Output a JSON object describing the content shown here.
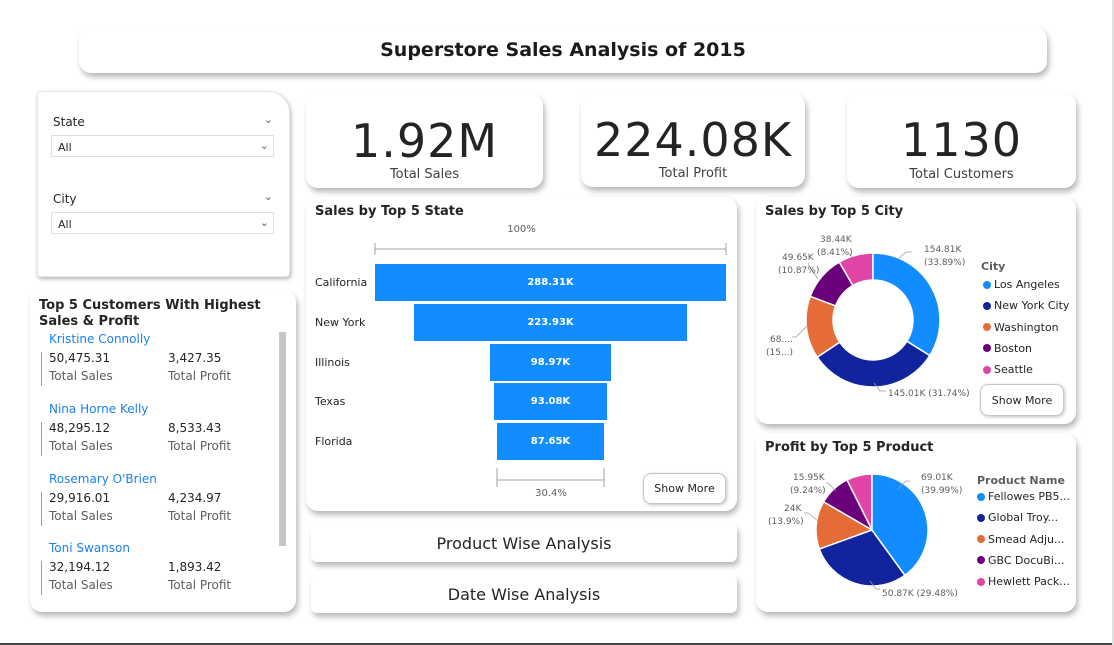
{
  "header": {
    "title": "Superstore Sales Analysis of 2015"
  },
  "filters": {
    "state": {
      "label": "State",
      "value": "All"
    },
    "city": {
      "label": "City",
      "value": "All"
    }
  },
  "kpis": {
    "sales": {
      "value": "1.92M",
      "label": "Total Sales"
    },
    "profit": {
      "value": "224.08K",
      "label": "Total Profit"
    },
    "customers": {
      "value": "1130",
      "label": "Total Customers"
    }
  },
  "customers": {
    "title": "Top 5 Customers With Highest Sales & Profit",
    "items": [
      {
        "name": "Kristine Connolly",
        "sales": "50,475.31",
        "profit": "3,427.35",
        "sales_label": "Total Sales",
        "profit_label": "Total Profit"
      },
      {
        "name": "Nina Horne Kelly",
        "sales": "48,295.12",
        "profit": "8,533.43",
        "sales_label": "Total Sales",
        "profit_label": "Total Profit"
      },
      {
        "name": "Rosemary O'Brien",
        "sales": "29,916.01",
        "profit": "4,234.97",
        "sales_label": "Total Sales",
        "profit_label": "Total Profit"
      },
      {
        "name": "Toni Swanson",
        "sales": "32,194.12",
        "profit": "1,893.42",
        "sales_label": "Total Sales",
        "profit_label": "Total Profit"
      }
    ]
  },
  "funnel": {
    "title": "Sales by Top 5 State",
    "top_pct": "100%",
    "bottom_pct": "30.4%",
    "show_more": "Show More"
  },
  "city_chart": {
    "title": "Sales by Top 5 City",
    "legend_title": "City",
    "show_more": "Show More",
    "labels": {
      "la": [
        "154.81K",
        "(33.89%)"
      ],
      "ny": [
        "145.01K (31.74%)"
      ],
      "wa": [
        "68....",
        "(15...)"
      ],
      "bo": [
        "49.65K",
        "(10.87%)"
      ],
      "se": [
        "38.44K",
        "(8.41%)"
      ]
    }
  },
  "product_chart": {
    "title": "Profit by Top 5 Product",
    "legend_title": "Product Name",
    "labels": {
      "p1": [
        "69.01K",
        "(39.99%)"
      ],
      "p2": [
        "50.87K (29.48%)"
      ],
      "p3": [
        "24K",
        "(13.9%)"
      ],
      "p4": [
        "15.95K",
        "(9.24%)"
      ]
    }
  },
  "nav": {
    "product": "Product Wise Analysis",
    "date": "Date Wise Analysis"
  },
  "colors": {
    "blue": "#118dff",
    "navy": "#12239e",
    "orange": "#e66c37",
    "purple": "#6b007b",
    "pink": "#e044a7"
  },
  "chart_data": [
    {
      "type": "bar",
      "title": "Sales by Top 5 State",
      "categories": [
        "California",
        "New York",
        "Illinois",
        "Texas",
        "Florida"
      ],
      "values": [
        288.31,
        223.93,
        98.97,
        93.08,
        87.65
      ],
      "value_labels": [
        "288.31K",
        "223.93K",
        "98.97K",
        "93.08K",
        "87.65K"
      ]
    },
    {
      "type": "pie",
      "title": "Sales by Top 5 City",
      "categories": [
        "Los Angeles",
        "New York City",
        "Washington",
        "Boston",
        "Seattle"
      ],
      "values": [
        154.81,
        145.01,
        68.9,
        49.65,
        38.44
      ],
      "percents": [
        33.89,
        31.74,
        15.09,
        10.87,
        8.41
      ]
    },
    {
      "type": "pie",
      "title": "Profit by Top 5 Product",
      "categories": [
        "Fellowes PB5...",
        "Global Troy...",
        "Smead Adju...",
        "GBC DocuBi...",
        "Hewlett Pack..."
      ],
      "values": [
        69.01,
        50.87,
        24,
        15.95,
        12.75
      ],
      "percents": [
        39.99,
        29.48,
        13.9,
        9.24,
        7.39
      ]
    }
  ]
}
